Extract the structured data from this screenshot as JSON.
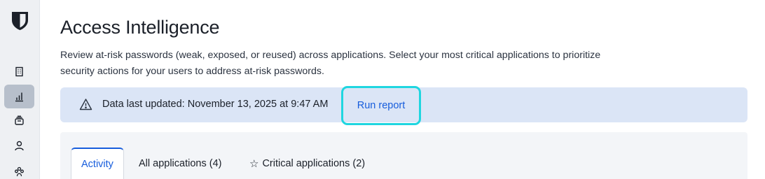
{
  "sidebar": {
    "logo_icon": "bitwarden-shield-icon",
    "items": [
      {
        "icon": "building-icon",
        "active": false
      },
      {
        "icon": "bar-chart-icon",
        "active": true
      },
      {
        "icon": "collection-icon",
        "active": false
      },
      {
        "icon": "person-icon",
        "active": false
      },
      {
        "icon": "group-icon",
        "active": false
      }
    ]
  },
  "page": {
    "title": "Access Intelligence",
    "description": "Review at-risk passwords (weak, exposed, or reused) across applications. Select your most critical applications to prioritize security actions for your users to address at-risk passwords."
  },
  "banner": {
    "icon": "warning-icon",
    "text": "Data last updated: November 13, 2025 at 9:47 AM",
    "action_label": "Run report"
  },
  "tabs": [
    {
      "label": "Activity",
      "active": true
    },
    {
      "label": "All applications (4)",
      "active": false
    },
    {
      "label": "Critical applications (2)",
      "active": false,
      "icon": "star-icon"
    }
  ],
  "colors": {
    "accent": "#175ddc",
    "banner_bg": "#dbe5f6",
    "highlight": "#1fd6e0",
    "sidebar_bg": "#eef0f3",
    "sidebar_active": "#b7bfcb"
  }
}
